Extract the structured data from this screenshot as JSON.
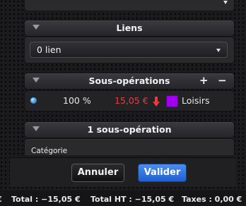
{
  "liens": {
    "title": "Liens",
    "select_value": "0 lien"
  },
  "sous_operations": {
    "title": "Sous-opérations",
    "add_label": "+",
    "remove_label": "−",
    "rows": [
      {
        "percent": "100 %",
        "amount": "15,05 €",
        "category": "Loisirs",
        "category_color": "#a000f0"
      }
    ]
  },
  "detail": {
    "title": "1 sous-opération",
    "category_label": "Catégorie"
  },
  "buttons": {
    "cancel": "Annuler",
    "ok": "Valider"
  },
  "status": {
    "prefix": "€",
    "total": "Total : −15,05 €",
    "total_ht": "Total HT : −15,05 €",
    "taxes": "Taxes : 0,00 €"
  },
  "colors": {
    "accent": "#2f7fe6",
    "negative": "#f03a3a"
  }
}
